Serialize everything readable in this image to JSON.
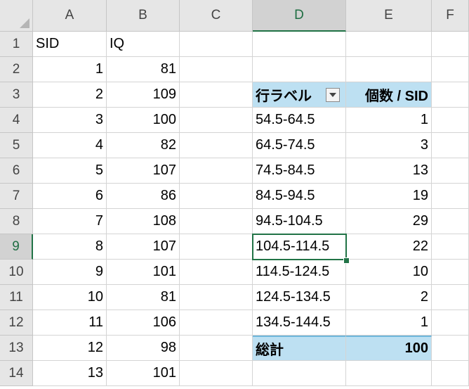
{
  "columns": [
    "A",
    "B",
    "C",
    "D",
    "E",
    "F"
  ],
  "rows": [
    "1",
    "2",
    "3",
    "4",
    "5",
    "6",
    "7",
    "8",
    "9",
    "10",
    "11",
    "12",
    "13",
    "14"
  ],
  "headers": {
    "sid": "SID",
    "iq": "IQ"
  },
  "data_rows": [
    {
      "sid": "1",
      "iq": "81"
    },
    {
      "sid": "2",
      "iq": "109"
    },
    {
      "sid": "3",
      "iq": "100"
    },
    {
      "sid": "4",
      "iq": "82"
    },
    {
      "sid": "5",
      "iq": "107"
    },
    {
      "sid": "6",
      "iq": "86"
    },
    {
      "sid": "7",
      "iq": "108"
    },
    {
      "sid": "8",
      "iq": "107"
    },
    {
      "sid": "9",
      "iq": "101"
    },
    {
      "sid": "10",
      "iq": "81"
    },
    {
      "sid": "11",
      "iq": "106"
    },
    {
      "sid": "12",
      "iq": "98"
    },
    {
      "sid": "13",
      "iq": "101"
    }
  ],
  "pivot": {
    "row_label_header": "行ラベル",
    "value_header": "個数 / SID",
    "rows": [
      {
        "label": "54.5-64.5",
        "count": "1"
      },
      {
        "label": "64.5-74.5",
        "count": "3"
      },
      {
        "label": "74.5-84.5",
        "count": "13"
      },
      {
        "label": "84.5-94.5",
        "count": "19"
      },
      {
        "label": "94.5-104.5",
        "count": "29"
      },
      {
        "label": "104.5-114.5",
        "count": "22"
      },
      {
        "label": "114.5-124.5",
        "count": "10"
      },
      {
        "label": "124.5-134.5",
        "count": "2"
      },
      {
        "label": "134.5-144.5",
        "count": "1"
      }
    ],
    "total_label": "総計",
    "total_value": "100"
  },
  "selection": {
    "column": "D",
    "row": "9"
  },
  "colors": {
    "accent": "#217346",
    "pivot_fill": "#bde0f2"
  }
}
